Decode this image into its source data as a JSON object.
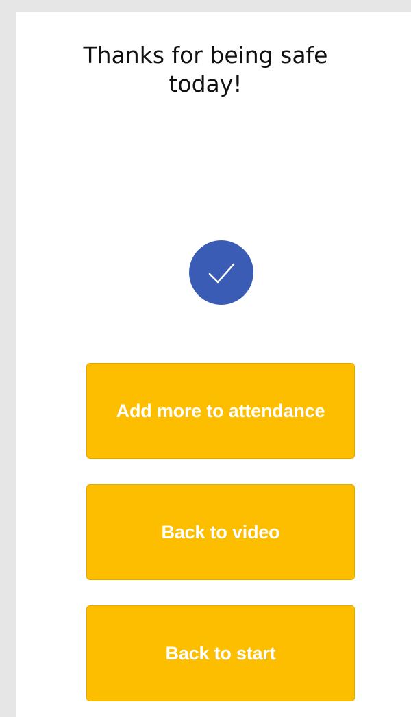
{
  "screen": {
    "title_line1": "Thanks for being safe",
    "title_line2": "today!",
    "check_icon": "checkmark-icon",
    "accent_color": "#3a5cb5",
    "button_color": "#fdbe00"
  },
  "buttons": {
    "add_more_label": "Add more to attendance",
    "back_to_video_label": "Back to video",
    "back_to_start_label": "Back to start"
  }
}
